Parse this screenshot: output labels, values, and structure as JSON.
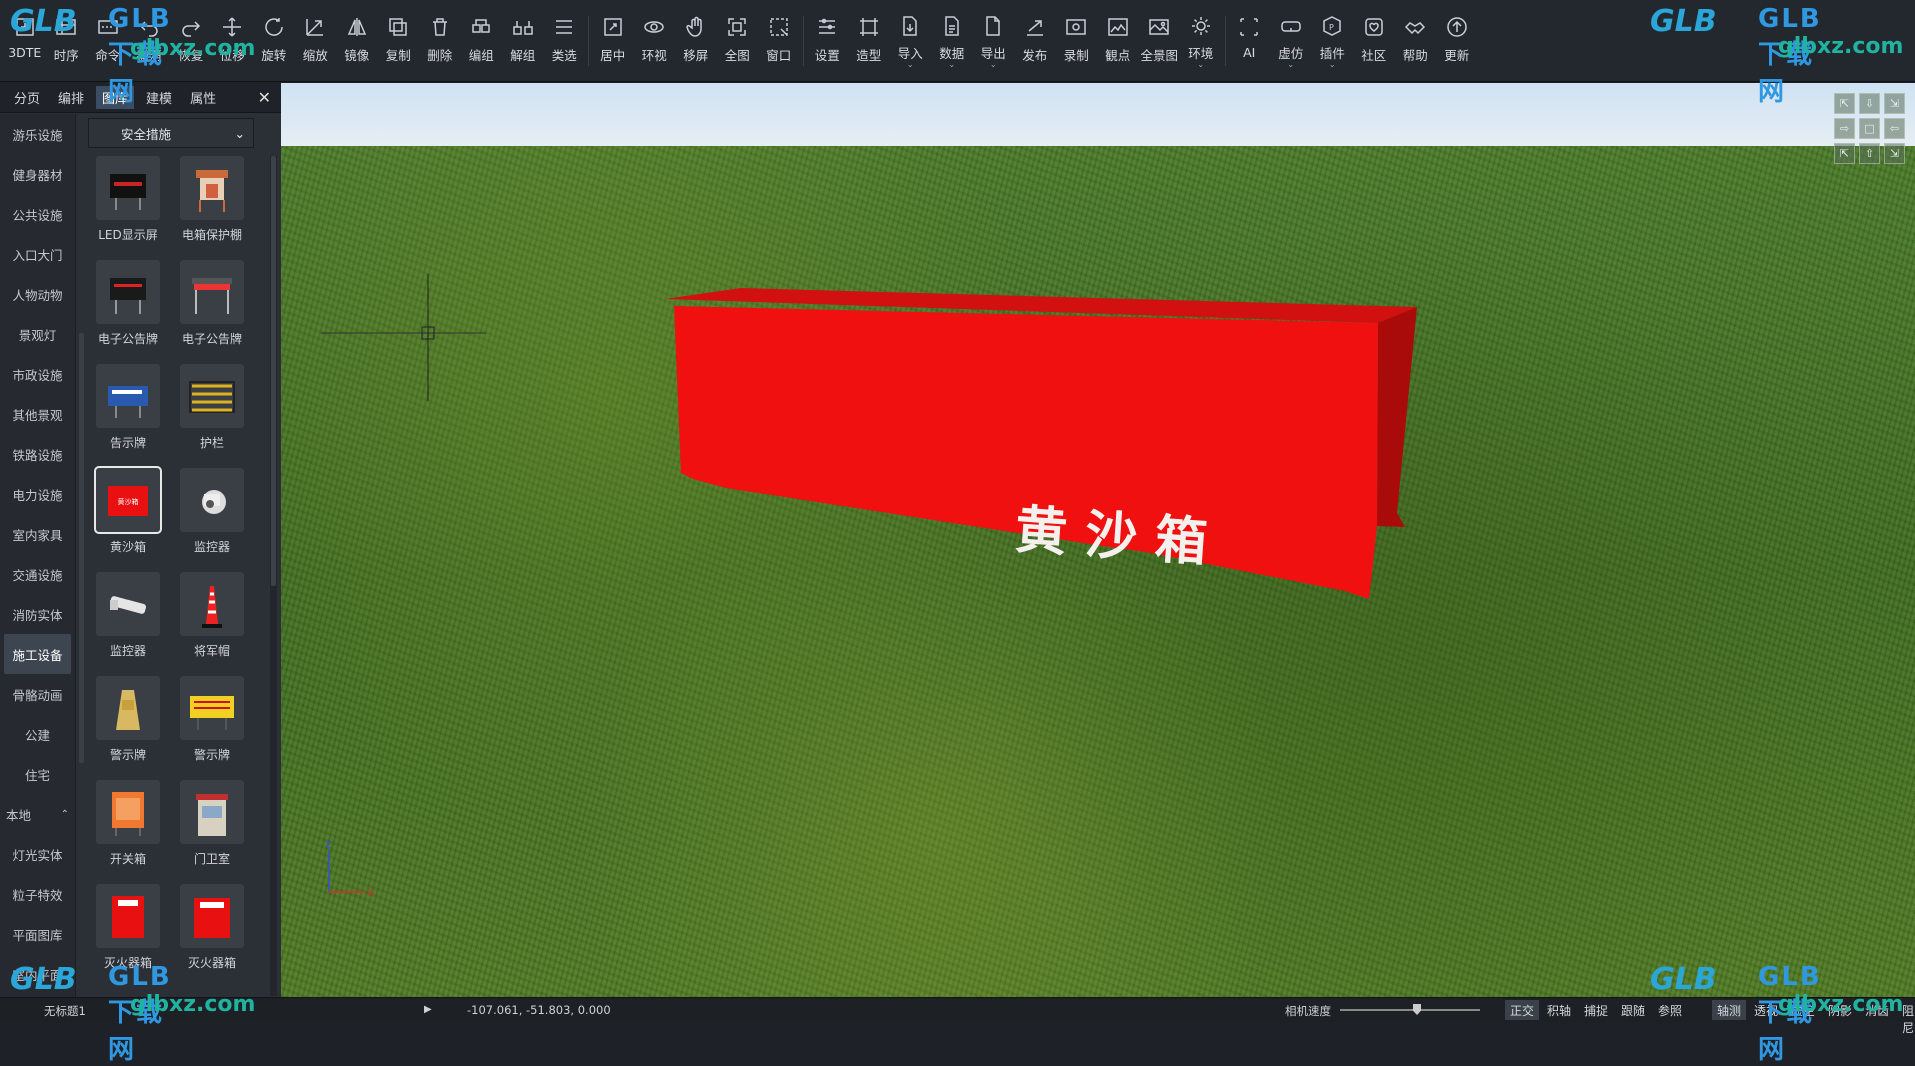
{
  "toolbar": {
    "items": [
      {
        "label": "3DTE",
        "icon": "add-icon"
      },
      {
        "label": "时序",
        "icon": "timeline-icon"
      },
      {
        "label": "命令",
        "icon": "command-icon"
      },
      {
        "label": "撤消",
        "icon": "undo-icon"
      },
      {
        "label": "恢复",
        "icon": "redo-icon"
      },
      {
        "label": "位移",
        "icon": "move-icon"
      },
      {
        "label": "旋转",
        "icon": "rotate-icon"
      },
      {
        "label": "缩放",
        "icon": "scale-icon"
      },
      {
        "label": "镜像",
        "icon": "mirror-icon"
      },
      {
        "label": "复制",
        "icon": "copy-icon"
      },
      {
        "label": "删除",
        "icon": "delete-icon"
      },
      {
        "label": "编组",
        "icon": "group-icon"
      },
      {
        "label": "解组",
        "icon": "ungroup-icon"
      },
      {
        "label": "类选",
        "icon": "select-similar-icon"
      },
      {
        "label": "居中",
        "icon": "center-icon"
      },
      {
        "label": "环视",
        "icon": "orbit-icon"
      },
      {
        "label": "移屏",
        "icon": "pan-icon"
      },
      {
        "label": "全图",
        "icon": "fit-all-icon"
      },
      {
        "label": "窗口",
        "icon": "window-zoom-icon"
      },
      {
        "label": "设置",
        "icon": "settings-icon"
      },
      {
        "label": "造型",
        "icon": "modeling-icon"
      },
      {
        "label": "导入",
        "icon": "import-icon",
        "dropdown": true
      },
      {
        "label": "数据",
        "icon": "data-icon",
        "dropdown": true
      },
      {
        "label": "导出",
        "icon": "export-icon",
        "dropdown": true
      },
      {
        "label": "发布",
        "icon": "publish-icon"
      },
      {
        "label": "录制",
        "icon": "record-icon"
      },
      {
        "label": "観点",
        "icon": "viewpoint-icon"
      },
      {
        "label": "全景图",
        "icon": "panorama-icon"
      },
      {
        "label": "环境",
        "icon": "environment-icon",
        "dropdown": true
      },
      {
        "label": "AI",
        "icon": "ai-icon"
      },
      {
        "label": "虚仿",
        "icon": "vr-icon",
        "dropdown": true
      },
      {
        "label": "插件",
        "icon": "plugin-icon",
        "dropdown": true
      },
      {
        "label": "社区",
        "icon": "community-icon"
      },
      {
        "label": "帮助",
        "icon": "help-icon"
      },
      {
        "label": "更新",
        "icon": "update-icon"
      }
    ]
  },
  "watermark": {
    "brand": "GLB下载网",
    "domain": "glbxz.com",
    "logo": "GLB"
  },
  "panel": {
    "tabs": [
      "分页",
      "编排",
      "图库",
      "建模",
      "属性"
    ],
    "active_tab": "图库",
    "categories": [
      "游乐设施",
      "健身器材",
      "公共设施",
      "入口大门",
      "人物动物",
      "景观灯",
      "市政设施",
      "其他景观",
      "铁路设施",
      "电力设施",
      "室内家具",
      "交通设施",
      "消防实体",
      "施工设备",
      "骨骼动画",
      "公建",
      "住宅",
      "本地",
      "灯光实体",
      "粒子特效",
      "平面图库",
      "室内平面"
    ],
    "active_category": "施工设备",
    "dropdown_value": "安全措施",
    "items": [
      {
        "label": "LED显示屏"
      },
      {
        "label": "电箱保护棚"
      },
      {
        "label": "电子公告牌"
      },
      {
        "label": "电子公告牌"
      },
      {
        "label": "告示牌"
      },
      {
        "label": "护栏"
      },
      {
        "label": "黄沙箱",
        "selected": true
      },
      {
        "label": "监控器"
      },
      {
        "label": "监控器"
      },
      {
        "label": "将军帽"
      },
      {
        "label": "警示牌"
      },
      {
        "label": "警示牌"
      },
      {
        "label": "开关箱"
      },
      {
        "label": "门卫室"
      },
      {
        "label": "灭火器箱"
      },
      {
        "label": "灭火器箱"
      }
    ]
  },
  "viewport": {
    "box_text": "黄 沙 箱",
    "box_color": "#f01010"
  },
  "status": {
    "filename": "无标题1",
    "coords": "-107.061, -51.803, 0.000",
    "camera_speed_label": "相机速度",
    "camera_speed": 0.55,
    "toggles": [
      {
        "label": "正交",
        "on": true
      },
      {
        "label": "积轴"
      },
      {
        "label": "捕捉"
      },
      {
        "label": "跟随"
      },
      {
        "label": "参照"
      },
      {
        "label": "轴测",
        "on": true
      },
      {
        "label": "透视"
      },
      {
        "label": "虚空"
      },
      {
        "label": "阴影"
      },
      {
        "label": "消齿"
      },
      {
        "label": "阻尼"
      }
    ]
  }
}
